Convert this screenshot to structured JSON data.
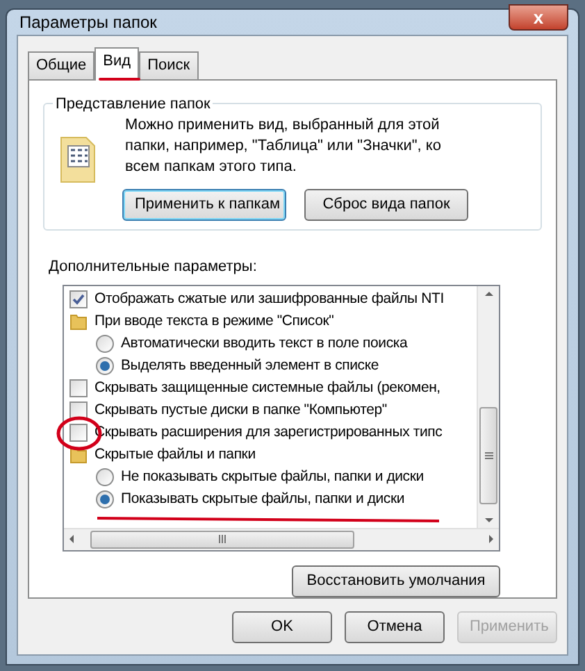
{
  "window": {
    "title": "Параметры папок",
    "close": "x"
  },
  "tabs": [
    {
      "label": "Общие",
      "selected": false
    },
    {
      "label": "Вид",
      "selected": true
    },
    {
      "label": "Поиск",
      "selected": false
    }
  ],
  "folder_views": {
    "title": "Представление папок",
    "description": "Можно применить вид, выбранный для этой папки, например, \"Таблица\" или \"Значки\", ко всем папкам этого типа.",
    "buttons": [
      {
        "label": "Применить к папкам",
        "focused": true
      },
      {
        "label": "Сброс вида папок",
        "focused": false
      }
    ]
  },
  "advanced": {
    "title": "Дополнительные параметры:",
    "items": [
      {
        "kind": "checkbox",
        "label": "Отображать сжатые или зашифрованные файлы NTI",
        "checked": true
      },
      {
        "kind": "group",
        "label": "При вводе текста в режиме \"Список\"",
        "children": [
          {
            "kind": "radio",
            "label": "Автоматически вводить текст в поле поиска",
            "selected": false
          },
          {
            "kind": "radio",
            "label": "Выделять введенный элемент в списке",
            "selected": true
          }
        ]
      },
      {
        "kind": "checkbox",
        "label": "Скрывать защищенные системные файлы (рекомен,",
        "checked": false
      },
      {
        "kind": "checkbox",
        "label": "Скрывать пустые диски в папке \"Компьютер\"",
        "checked": false
      },
      {
        "kind": "checkbox",
        "label": "Скрывать расширения для зарегистрированных типс",
        "checked": false
      },
      {
        "kind": "group",
        "label": "Скрытые файлы и папки",
        "children": [
          {
            "kind": "radio",
            "label": "Не показывать скрытые файлы, папки и диски",
            "selected": false
          },
          {
            "kind": "radio",
            "label": "Показывать скрытые файлы, папки и диски",
            "selected": true
          }
        ]
      }
    ]
  },
  "restore_button": {
    "label": "Восстановить умолчания"
  },
  "footer_buttons": [
    {
      "label": "OK",
      "disabled": false
    },
    {
      "label": "Отмена",
      "disabled": false
    },
    {
      "label": "Применить",
      "disabled": true
    }
  ]
}
